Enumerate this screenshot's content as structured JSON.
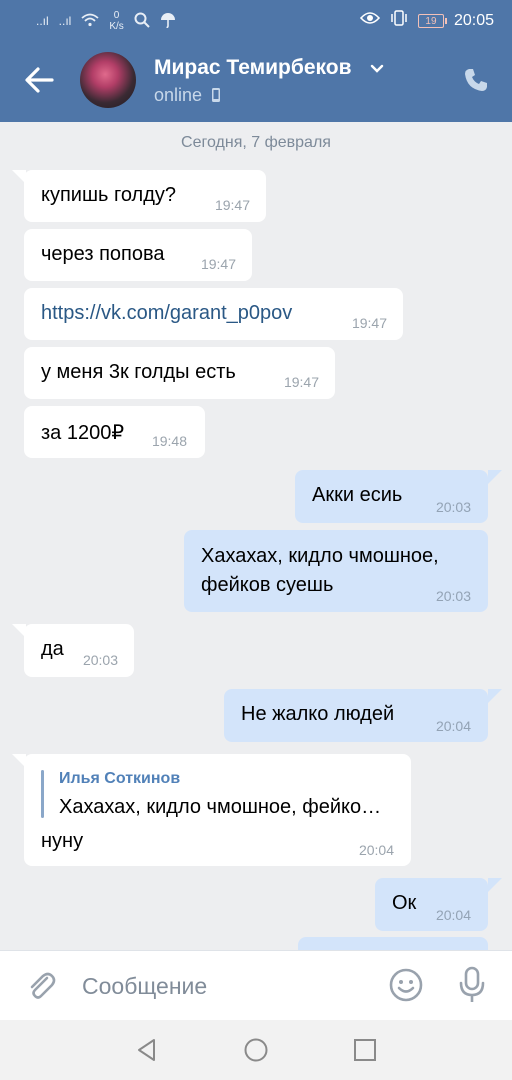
{
  "status_bar": {
    "signal1": "..ıl",
    "signal2": "..ıl",
    "net_speed_value": "0",
    "net_speed_unit": "K/s",
    "battery_level": "19",
    "time": "20:05"
  },
  "header": {
    "contact_name": "Мирас Темирбеков",
    "status": "online"
  },
  "chat": {
    "date_separator": "Сегодня, 7 февраля",
    "messages": [
      {
        "text": "купишь голду?",
        "time": "19:47",
        "direction": "in"
      },
      {
        "text": "через попова",
        "time": "19:47",
        "direction": "in"
      },
      {
        "text": "https://vk.com/garant_p0pov",
        "time": "19:47",
        "direction": "in",
        "is_link": true
      },
      {
        "text": "у меня 3к голды есть",
        "time": "19:47",
        "direction": "in"
      },
      {
        "text": "за 1200₽",
        "time": "19:48",
        "direction": "in"
      },
      {
        "text": "Акки есиь",
        "time": "20:03",
        "direction": "out"
      },
      {
        "text_line1": "Хахахах, кидло чмошное,",
        "text_line2": "фейков суешь",
        "time": "20:03",
        "direction": "out"
      },
      {
        "text": "да",
        "time": "20:03",
        "direction": "in"
      },
      {
        "text": "Не жалко людей",
        "time": "20:04",
        "direction": "out"
      },
      {
        "reply_author": "Илья Соткинов",
        "reply_quote": "Хахахах, кидло чмошное, фейко…",
        "text": "нуну",
        "time": "20:04",
        "direction": "in"
      },
      {
        "text": "Ок",
        "time": "20:04",
        "direction": "out"
      }
    ]
  },
  "composer": {
    "placeholder": "Сообщение"
  },
  "colors": {
    "header_bg": "#4f76a8",
    "chat_bg": "#edeef0",
    "incoming_bubble": "#ffffff",
    "outgoing_bubble": "#d3e4fa",
    "link": "#2a5885"
  }
}
